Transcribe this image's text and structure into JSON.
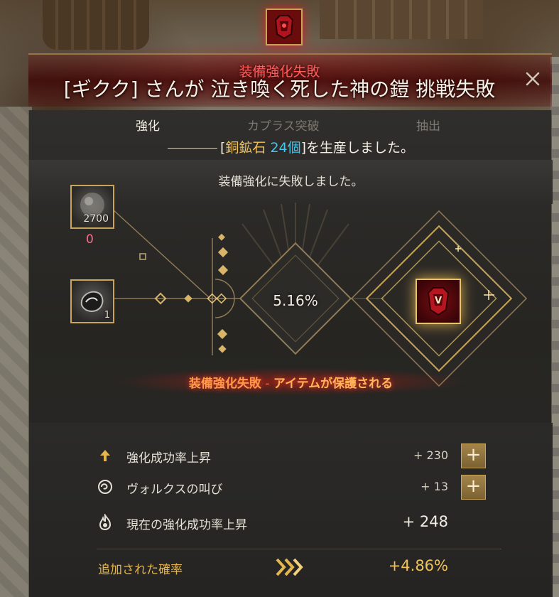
{
  "banner": {
    "subtitle": "装備強化失敗",
    "title": "[ギクク] さんが 泣き喚く死した神の鎧 挑戦失敗"
  },
  "tabs": [
    {
      "label": "強化",
      "active": true
    },
    {
      "label": "カプラス突破",
      "active": false
    },
    {
      "label": "抽出",
      "active": false
    }
  ],
  "produced": {
    "prefix": "[",
    "item": "銅鉱石",
    "count": "24個",
    "suffix": "]を生産しました。"
  },
  "result_message": "装備強化に失敗しました。",
  "slots": {
    "ore_qty": "2700",
    "ore_count": "0",
    "stone_qty": "1"
  },
  "chance": "5.16%",
  "status": {
    "main": "装備強化失敗",
    "dash": " - ",
    "sub": "アイテムが保護される"
  },
  "bonuses": [
    {
      "icon": "arrow-up-icon",
      "label": "強化成功率上昇",
      "value": "+ 230",
      "has_button": true
    },
    {
      "icon": "spiral-icon",
      "label": "ヴォルクスの叫び",
      "value": "+ 13",
      "has_button": true
    },
    {
      "icon": "flame-icon",
      "label": "現在の強化成功率上昇",
      "value": "+ 248",
      "has_button": false
    }
  ],
  "added": {
    "label": "追加された確率",
    "value": "+4.86%"
  },
  "plus_label": "+",
  "target_letter": "V",
  "colors": {
    "gold": "#c9a55a",
    "fail_red": "#ff5b5b",
    "count_cyan": "#3fc7f0",
    "item_gold": "#f2c25b",
    "status_orange": "#ff9a4a"
  }
}
